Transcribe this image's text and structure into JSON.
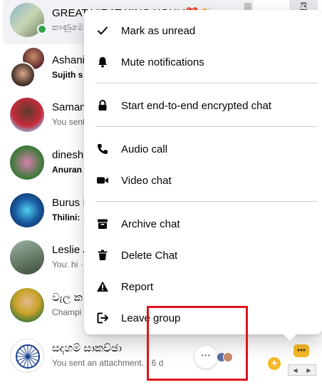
{
  "chats": [
    {
      "name": "GREAT VIRAT KING KOHLI❤️👏",
      "preview": "කාණුමෙ"
    },
    {
      "name": "Ashani",
      "preview": "Sujith s"
    },
    {
      "name": "Saman",
      "preview": "You sent"
    },
    {
      "name": "dinesh",
      "preview": "Anuran"
    },
    {
      "name": "Burus I",
      "preview": "Thilini:"
    },
    {
      "name": "Leslie J",
      "preview": "You: hi ·"
    },
    {
      "name": "වැල ක",
      "preview": "Champi"
    },
    {
      "name": "සදහම් සාකච්ඡා",
      "preview": "You sent an attachment. · 6 d"
    }
  ],
  "right_tab_text": "යි",
  "menu": {
    "items": [
      {
        "label": "Mark as unread",
        "icon": "checkmark-icon"
      },
      {
        "label": "Mute notifications",
        "icon": "bell-icon"
      },
      {
        "label": "Start end-to-end encrypted chat",
        "icon": "lock-icon"
      },
      {
        "label": "Audio call",
        "icon": "phone-icon"
      },
      {
        "label": "Video chat",
        "icon": "video-camera-icon"
      },
      {
        "label": "Archive chat",
        "icon": "archive-box-icon"
      },
      {
        "label": "Delete Chat",
        "icon": "trash-icon"
      },
      {
        "label": "Report",
        "icon": "warning-triangle-icon"
      },
      {
        "label": "Leave group",
        "icon": "leave-group-icon"
      }
    ]
  },
  "more_button_label": "···",
  "colors": {
    "online": "#31a24c",
    "highlight": "#e0131d",
    "accent_yellow": "#f7b928"
  }
}
